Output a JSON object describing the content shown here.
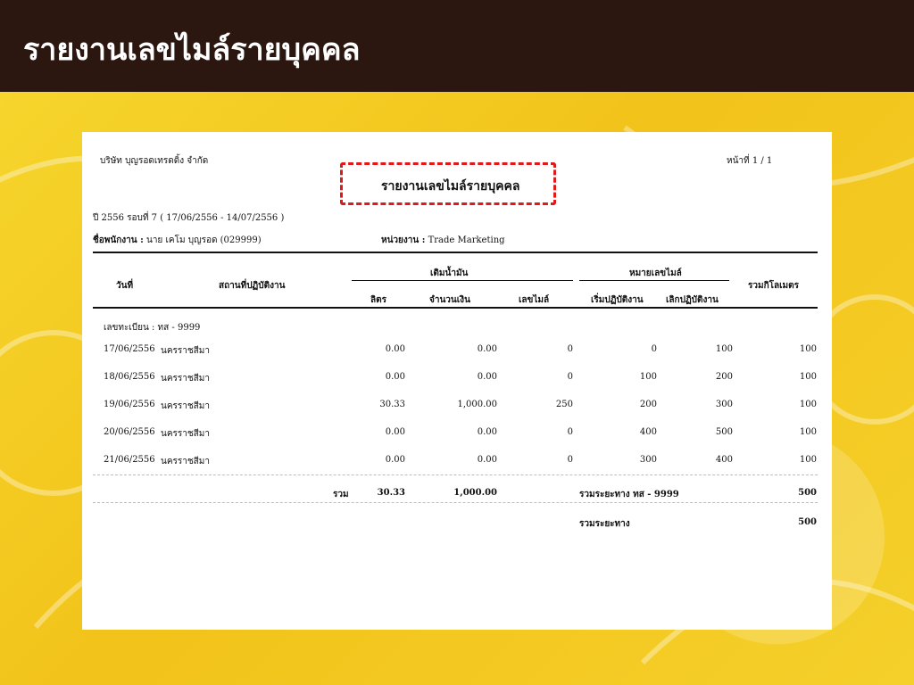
{
  "slide": {
    "title": "รายงานเลขไมล์รายบุคคล"
  },
  "report": {
    "company": "บริษัท บุญรอดเทรดดิ้ง จำกัด",
    "page": "หน้าที่ 1 / 1",
    "title": "รายงานเลขไมล์รายบุคคล",
    "period": "ปี 2556 รอบที่ 7 ( 17/06/2556 - 14/07/2556 )",
    "employee_label": "ชื่อพนักงาน :",
    "employee_value": "นาย เคโม บุญรอด (029999)",
    "dept_label": "หน่วยงาน :",
    "dept_value": "Trade Marketing",
    "headers": {
      "date": "วันที่",
      "location": "สถานที่ปฏิบัติงาน",
      "fuel_group": "เติมน้ำมัน",
      "liters": "ลิตร",
      "amount": "จำนวนเงิน",
      "mileage": "เลขไมล์",
      "mile_group": "หมายเลขไมล์",
      "start": "เริ่มปฏิบัติงาน",
      "end": "เลิกปฏิบัติงาน",
      "total_km": "รวมกิโลเมตร"
    },
    "plate": "เลขทะเบียน : ทส - 9999",
    "rows": [
      {
        "date": "17/06/2556",
        "location": "นครราชสีมา",
        "liters": "0.00",
        "amount": "0.00",
        "mileage": "0",
        "start": "0",
        "end": "100",
        "total": "100"
      },
      {
        "date": "18/06/2556",
        "location": "นครราชสีมา",
        "liters": "0.00",
        "amount": "0.00",
        "mileage": "0",
        "start": "100",
        "end": "200",
        "total": "100"
      },
      {
        "date": "19/06/2556",
        "location": "นครราชสีมา",
        "liters": "30.33",
        "amount": "1,000.00",
        "mileage": "250",
        "start": "200",
        "end": "300",
        "total": "100"
      },
      {
        "date": "20/06/2556",
        "location": "นครราชสีมา",
        "liters": "0.00",
        "amount": "0.00",
        "mileage": "0",
        "start": "400",
        "end": "500",
        "total": "100"
      },
      {
        "date": "21/06/2556",
        "location": "นครราชสีมา",
        "liters": "0.00",
        "amount": "0.00",
        "mileage": "0",
        "start": "300",
        "end": "400",
        "total": "100"
      }
    ],
    "summary": {
      "sum_label": "รวม",
      "sum_liters": "30.33",
      "sum_amount": "1,000.00",
      "plate_total_label": "รวมระยะทาง ทส - 9999",
      "plate_total": "500",
      "grand_total_label": "รวมระยะทาง",
      "grand_total": "500"
    }
  },
  "colors": {
    "title_bar": "#2b1710",
    "highlight": "#e0191b",
    "background": "#f3c81c"
  }
}
